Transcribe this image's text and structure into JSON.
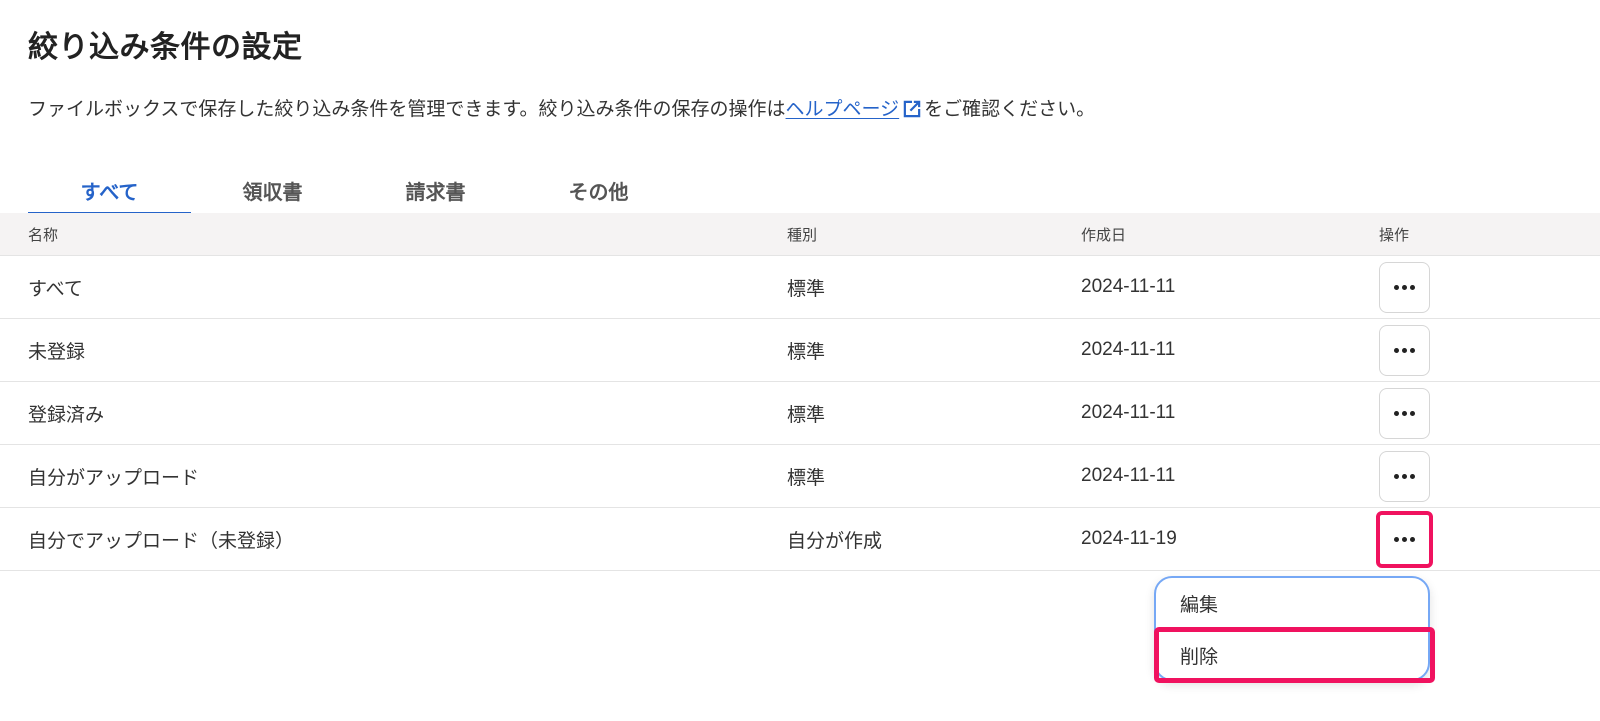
{
  "page": {
    "title": "絞り込み条件の設定",
    "description_before": "ファイルボックスで保存した絞り込み条件を管理できます。絞り込み条件の保存の操作は",
    "help_link_label": "ヘルプページ",
    "description_after": "をご確認ください。",
    "link_icon": "external-link-icon"
  },
  "tabs": [
    {
      "label": "すべて",
      "active": true
    },
    {
      "label": "領収書",
      "active": false
    },
    {
      "label": "請求書",
      "active": false
    },
    {
      "label": "その他",
      "active": false
    }
  ],
  "table": {
    "columns": {
      "name": "名称",
      "type": "種別",
      "created": "作成日",
      "actions": "操作"
    },
    "rows": [
      {
        "name": "すべて",
        "type": "標準",
        "created": "2024-11-11"
      },
      {
        "name": "未登録",
        "type": "標準",
        "created": "2024-11-11"
      },
      {
        "name": "登録済み",
        "type": "標準",
        "created": "2024-11-11"
      },
      {
        "name": "自分がアップロード",
        "type": "標準",
        "created": "2024-11-11"
      },
      {
        "name": "自分でアップロード（未登録）",
        "type": "自分が作成",
        "created": "2024-11-19"
      }
    ],
    "actions_icon": "more-horizontal-icon"
  },
  "dropdown": {
    "items": [
      {
        "label": "編集"
      },
      {
        "label": "削除"
      }
    ]
  },
  "colors": {
    "accent": "#2563c9",
    "highlight": "#f0125f",
    "header_bg": "#f5f3f3",
    "dropdown_border": "#76a8f5"
  }
}
